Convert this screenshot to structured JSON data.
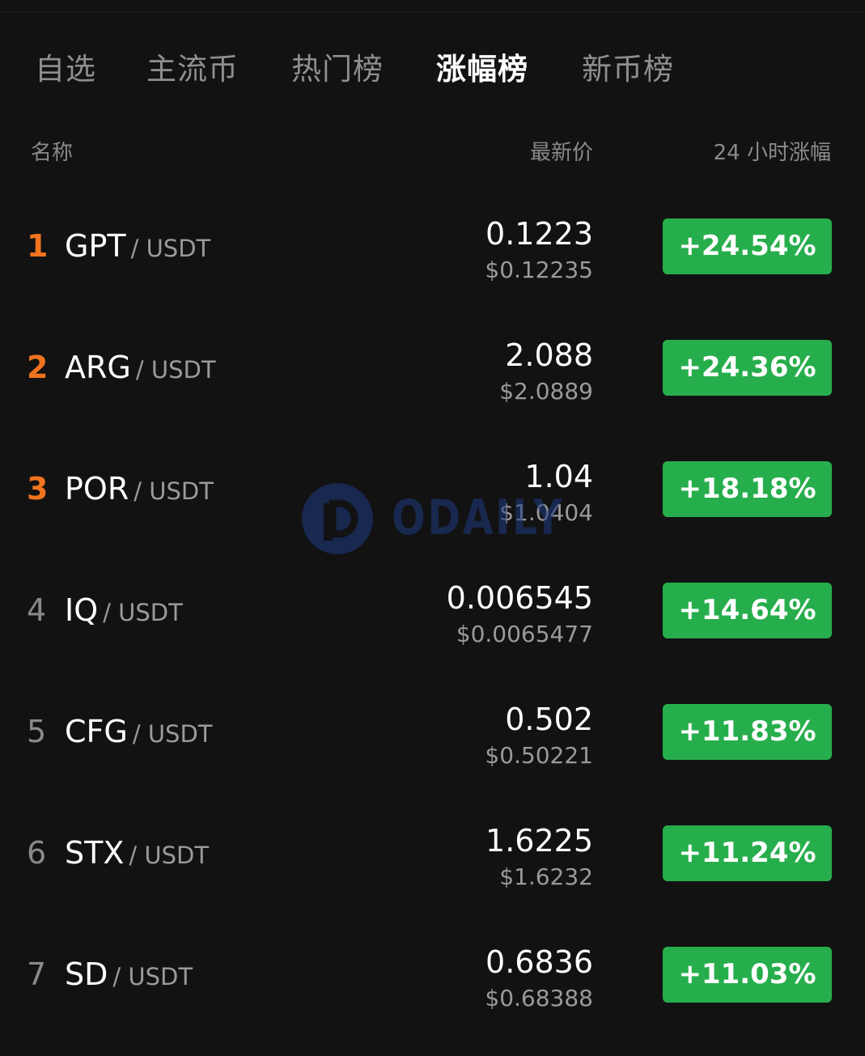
{
  "tabs": [
    {
      "label": "自选",
      "active": false
    },
    {
      "label": "主流币",
      "active": false
    },
    {
      "label": "热门榜",
      "active": false
    },
    {
      "label": "涨幅榜",
      "active": true
    },
    {
      "label": "新币榜",
      "active": false
    }
  ],
  "columns": {
    "name": "名称",
    "price": "最新价",
    "change": "24 小时涨幅"
  },
  "rows": [
    {
      "rank": "1",
      "symbol": "GPT",
      "quote": "/ USDT",
      "price": "0.1223",
      "fiat": "$0.12235",
      "change": "+24.54%"
    },
    {
      "rank": "2",
      "symbol": "ARG",
      "quote": "/ USDT",
      "price": "2.088",
      "fiat": "$2.0889",
      "change": "+24.36%"
    },
    {
      "rank": "3",
      "symbol": "POR",
      "quote": "/ USDT",
      "price": "1.04",
      "fiat": "$1.0404",
      "change": "+18.18%"
    },
    {
      "rank": "4",
      "symbol": "IQ",
      "quote": "/ USDT",
      "price": "0.006545",
      "fiat": "$0.0065477",
      "change": "+14.64%"
    },
    {
      "rank": "5",
      "symbol": "CFG",
      "quote": "/ USDT",
      "price": "0.502",
      "fiat": "$0.50221",
      "change": "+11.83%"
    },
    {
      "rank": "6",
      "symbol": "STX",
      "quote": "/ USDT",
      "price": "1.6225",
      "fiat": "$1.6232",
      "change": "+11.24%"
    },
    {
      "rank": "7",
      "symbol": "SD",
      "quote": "/ USDT",
      "price": "0.6836",
      "fiat": "$0.68388",
      "change": "+11.03%"
    }
  ],
  "watermark": {
    "text": "ODAILY"
  },
  "colors": {
    "background": "#121212",
    "top_rank": "#f0731e",
    "rise_badge": "#27ae4c",
    "watermark": "#1e3a80"
  }
}
